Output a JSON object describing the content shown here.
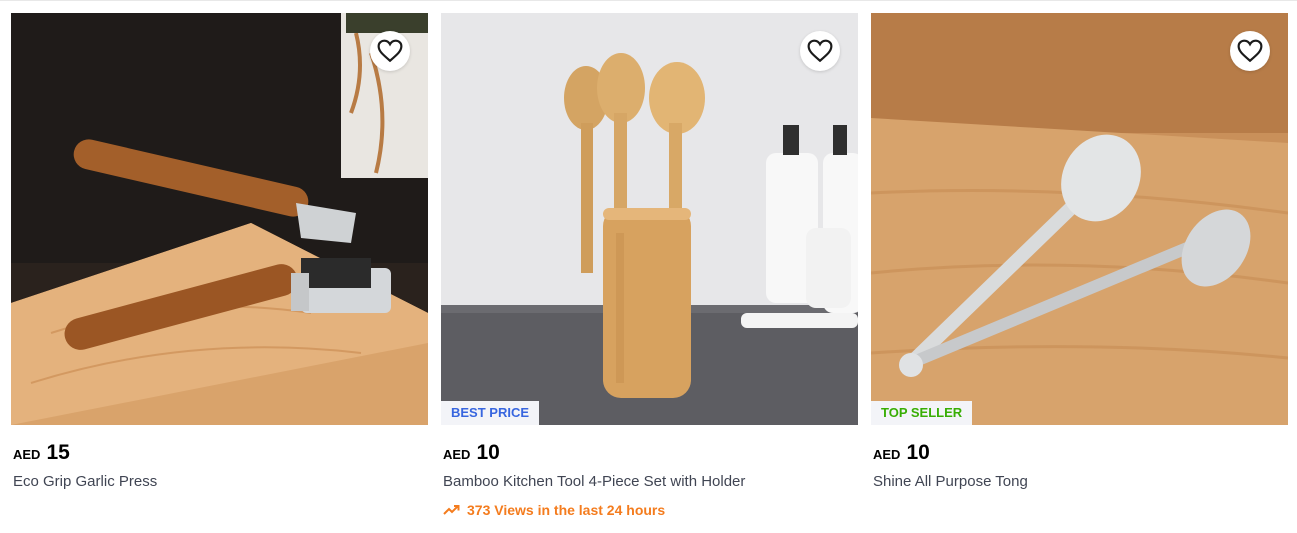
{
  "products": [
    {
      "currency": "AED",
      "price": "15",
      "title": "Eco Grip Garlic Press",
      "badge": "",
      "views": ""
    },
    {
      "currency": "AED",
      "price": "10",
      "title": "Bamboo Kitchen Tool 4-Piece Set with Holder",
      "badge": "BEST PRICE",
      "views": "373 Views in the last 24 hours"
    },
    {
      "currency": "AED",
      "price": "10",
      "title": "Shine All Purpose Tong",
      "badge": "TOP SELLER",
      "views": ""
    }
  ],
  "colors": {
    "best_price_badge": "#3866df",
    "top_seller_badge": "#38ae04",
    "views_accent": "#f47c1e"
  },
  "icons": [
    "heart-outline-icon",
    "trending-up-icon"
  ]
}
